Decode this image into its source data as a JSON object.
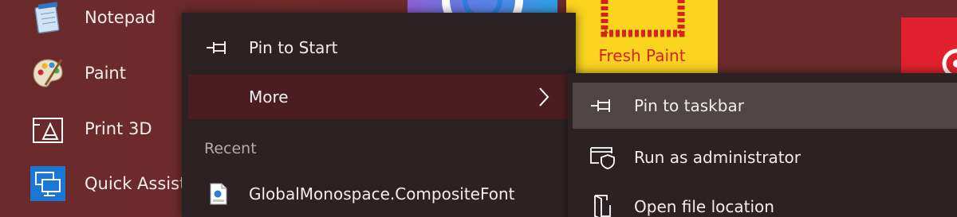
{
  "app_list": [
    {
      "label": "Notepad",
      "icon": "notepad-icon"
    },
    {
      "label": "Paint",
      "icon": "paint-palette-icon"
    },
    {
      "label": "Print 3D",
      "icon": "print-3d-icon"
    },
    {
      "label": "Quick Assist",
      "icon": "quick-assist-icon"
    }
  ],
  "tiles": {
    "fresh_paint_label": "Fresh Paint"
  },
  "context_menu": {
    "pin_to_start": "Pin to Start",
    "more": "More",
    "recent_heading": "Recent",
    "recent_items": [
      {
        "label": "GlobalMonospace.CompositeFont",
        "icon": "xml-file-icon"
      }
    ]
  },
  "submenu": {
    "pin_to_taskbar": "Pin to taskbar",
    "run_as_admin": "Run as administrator",
    "open_file_location": "Open file location"
  },
  "colors": {
    "background": "#6a2a2b",
    "menu_bg": "#2c2223",
    "more_highlight": "#4b1d21",
    "submenu_highlight": "#4e4646",
    "fresh_paint_tile": "#fbd41f",
    "fresh_paint_text": "#d8231c"
  }
}
